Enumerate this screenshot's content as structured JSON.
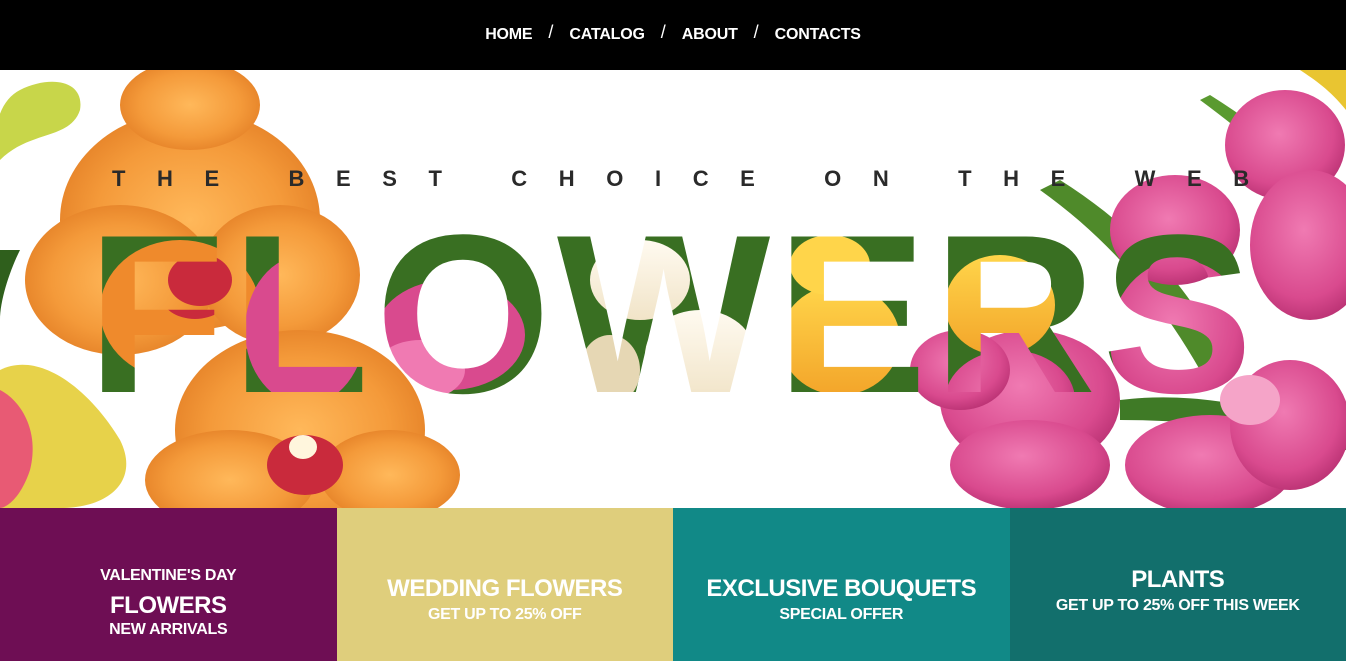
{
  "nav": {
    "items": [
      "HOME",
      "CATALOG",
      "ABOUT",
      "CONTACTS"
    ],
    "separator": "/"
  },
  "hero": {
    "tagline": "THE BEST CHOICE ON THE WEB",
    "headline": "FLOWERS",
    "image": "orchid-and-tulip-flowers-photo"
  },
  "promos": [
    {
      "kicker": "VALENTINE'S DAY",
      "title": "FLOWERS",
      "subtitle": "NEW ARRIVALS",
      "color": "#6e0e54"
    },
    {
      "title": "WEDDING FLOWERS",
      "subtitle": "GET UP TO 25% OFF",
      "color": "#dfce7c"
    },
    {
      "title": "EXCLUSIVE BOUQUETS",
      "subtitle": "SPECIAL OFFER",
      "color": "#118987"
    },
    {
      "title": "PLANTS",
      "subtitle": "GET UP TO 25% OFF THIS WEEK",
      "color": "#126f6c"
    }
  ],
  "colors": {
    "nav_bg": "#000000",
    "orchid": "#f4993a",
    "tulip": "#de4f93",
    "leaf": "#4f8a2a"
  }
}
